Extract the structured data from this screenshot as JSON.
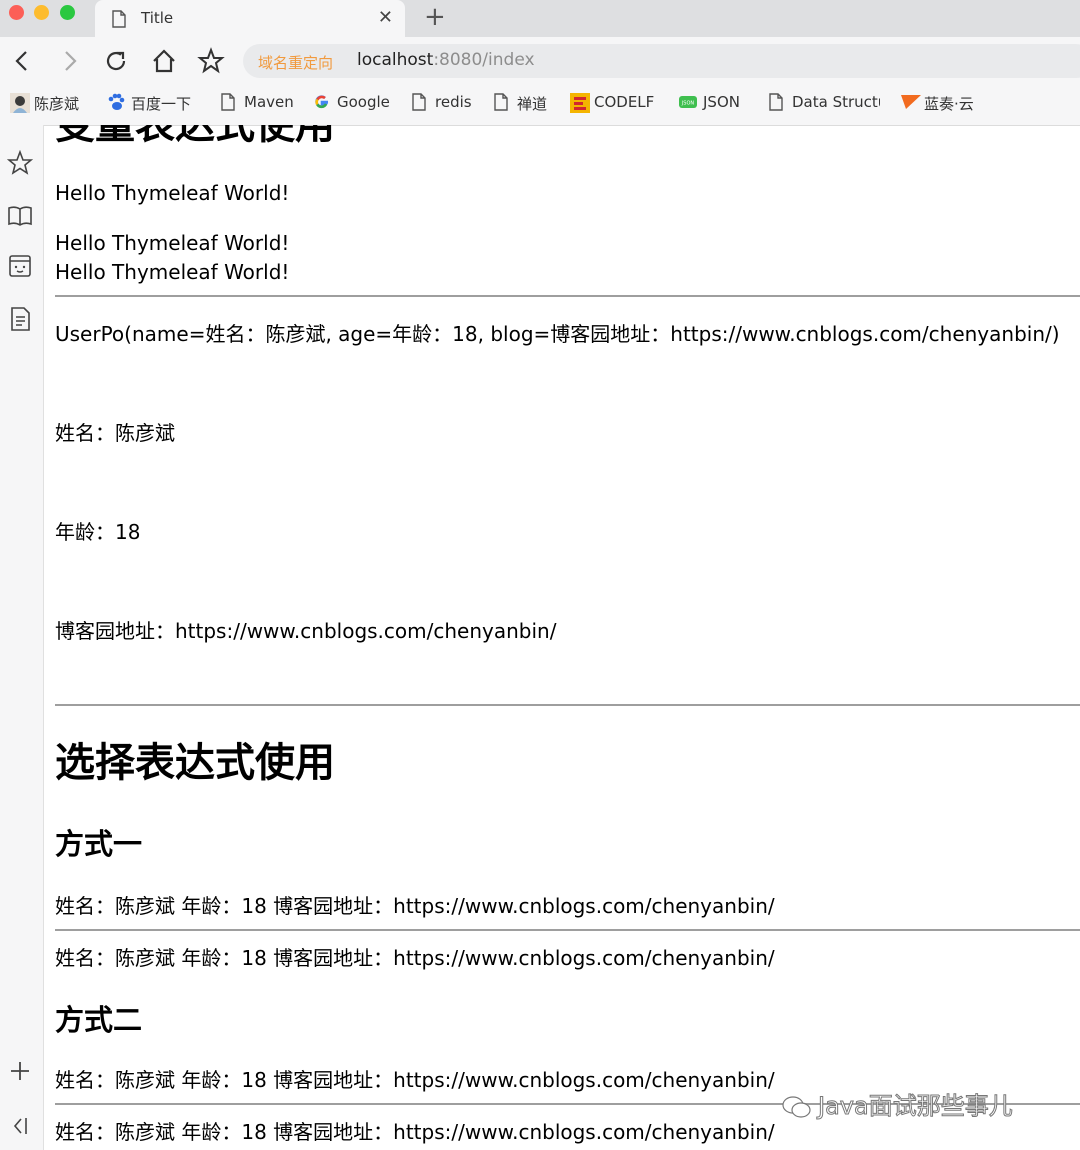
{
  "browser": {
    "tab_title": "Title",
    "address": {
      "redirect_badge": "域名重定向",
      "host": "localhost",
      "rest": ":8080/index"
    },
    "bookmarks": [
      {
        "label": "陈彦斌",
        "icon": "avatar-icon"
      },
      {
        "label": "百度一下",
        "icon": "baidu-paw-icon"
      },
      {
        "label": "Maven",
        "icon": "page-icon"
      },
      {
        "label": "Google",
        "icon": "google-g-icon"
      },
      {
        "label": "redis",
        "icon": "page-icon"
      },
      {
        "label": "禅道",
        "icon": "page-icon"
      },
      {
        "label": "CODELF",
        "icon": "codelf-icon"
      },
      {
        "label": "JSON",
        "icon": "json-icon"
      },
      {
        "label": "Data Structu",
        "icon": "page-icon"
      },
      {
        "label": "蓝奏·云",
        "icon": "lanzou-flag-icon"
      }
    ]
  },
  "page": {
    "cut_heading": "变量表达式使用",
    "hello_1": "Hello Thymeleaf World!",
    "hello_2": "Hello Thymeleaf World!",
    "hello_3": "Hello Thymeleaf World!",
    "user_po": "UserPo(name=姓名：陈彦斌, age=年龄：18, blog=博客园地址：https://www.cnblogs.com/chenyanbin/)",
    "name_line": "姓名：陈彦斌",
    "age_line": "年龄：18",
    "blog_line": "博客园地址：https://www.cnblogs.com/chenyanbin/",
    "section_title": "选择表达式使用",
    "method_1": {
      "title": "方式一",
      "line_1": "姓名：陈彦斌 年龄：18 博客园地址：https://www.cnblogs.com/chenyanbin/",
      "line_2": "姓名：陈彦斌 年龄：18 博客园地址：https://www.cnblogs.com/chenyanbin/"
    },
    "method_2": {
      "title": "方式二",
      "line_1": "姓名：陈彦斌 年龄：18 博客园地址：https://www.cnblogs.com/chenyanbin/",
      "line_2": "姓名：陈彦斌 年龄：18 博客园地址：https://www.cnblogs.com/chenyanbin/"
    }
  },
  "watermark": "Java面试那些事儿",
  "colors": {
    "accent_orange": "#f19a3e",
    "chrome_bg": "#f6f6f7",
    "rule_gray": "#9e9e9e"
  }
}
